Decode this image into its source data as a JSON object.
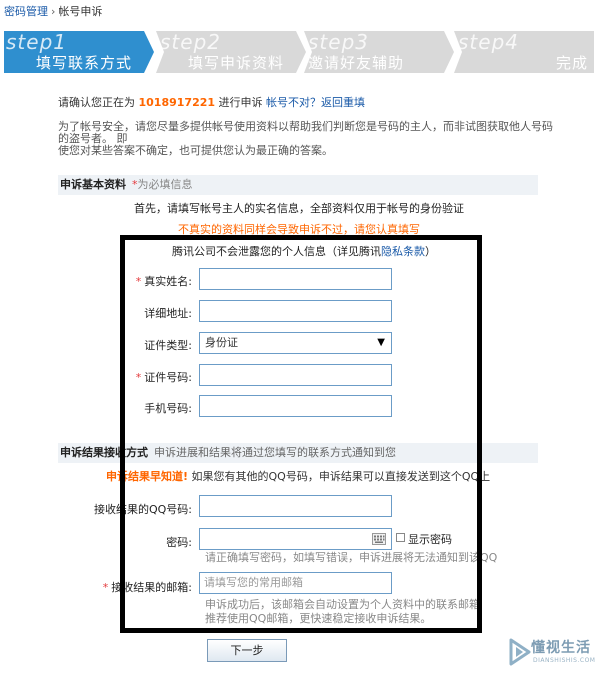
{
  "breadcrumb": {
    "parent": "密码管理",
    "separator": "›",
    "current": "帐号申诉"
  },
  "steps": [
    {
      "num": "step1",
      "label": "填写联系方式",
      "active": true
    },
    {
      "num": "step2",
      "label": "填写申诉资料",
      "active": false
    },
    {
      "num": "step3",
      "label": "邀请好友辅助",
      "active": false
    },
    {
      "num": "step4",
      "label": "完成",
      "active": false
    }
  ],
  "colors": {
    "active_step": "#2f8fcf",
    "inactive_step": "#d9d9d9",
    "accent": "#ff6600",
    "link": "#1a5aa8",
    "required": "#e4393c",
    "input_border": "#6b9cc7"
  },
  "confirm": {
    "prefix": "请确认您正在为 ",
    "qq": "1018917221",
    "middle": " 进行申诉 ",
    "link": "帐号不对？返回重填"
  },
  "notice": {
    "line1": "为了帐号安全，请您尽量多提供帐号使用资料以帮助我们判断您是号码的主人，而非试图获取他人号码的盗号者。 即",
    "line2": "使您对某些答案不确定，也可提供您认为最正确的答案。"
  },
  "basic": {
    "title": "申诉基本资料",
    "required_mark": "*",
    "required_text": "为必填信息",
    "intro": "首先，请填写帐号主人的实名信息，全部资料仅用于帐号的身份验证",
    "warning": "不真实的资料同样会导致申诉不过，请您认真填写",
    "privacy_prefix": "腾讯公司不会泄露您的个人信息（详见腾讯",
    "privacy_link": "隐私条款",
    "privacy_suffix": "）",
    "fields": {
      "name": {
        "label": "真实姓名:",
        "value": ""
      },
      "address": {
        "label": "详细地址:",
        "value": ""
      },
      "id_type": {
        "label": "证件类型:",
        "value": "身份证"
      },
      "id_number": {
        "label": "证件号码:",
        "value": ""
      },
      "phone": {
        "label": "手机号码:",
        "value": ""
      }
    }
  },
  "result": {
    "title": "申诉结果接收方式",
    "hint": "申诉进展和结果将通过您填写的联系方式通知到您",
    "early_highlight": "申诉结果早知道!",
    "early_text": " 如果您有其他的QQ号码，申诉结果可以直接发送到这个QQ上",
    "qq_label": "接收结果的QQ号码:",
    "qq_value": "",
    "password_label": "密码:",
    "password_value": "",
    "show_password": "显示密码",
    "password_hint": "请正确填写密码，如填写错误，申诉进展将无法通知到该QQ",
    "email_label": "接收结果的邮箱:",
    "email_placeholder": "请填写您的常用邮箱",
    "email_hint1": "申诉成功后，该邮箱会自动设置为个人资料中的联系邮箱",
    "email_hint2": "推荐使用QQ邮箱，更快速稳定接收申诉结果。"
  },
  "next_button": "下一步",
  "watermark": {
    "text": "懂视生活",
    "sub": "DIANSHISHIS.COM"
  }
}
